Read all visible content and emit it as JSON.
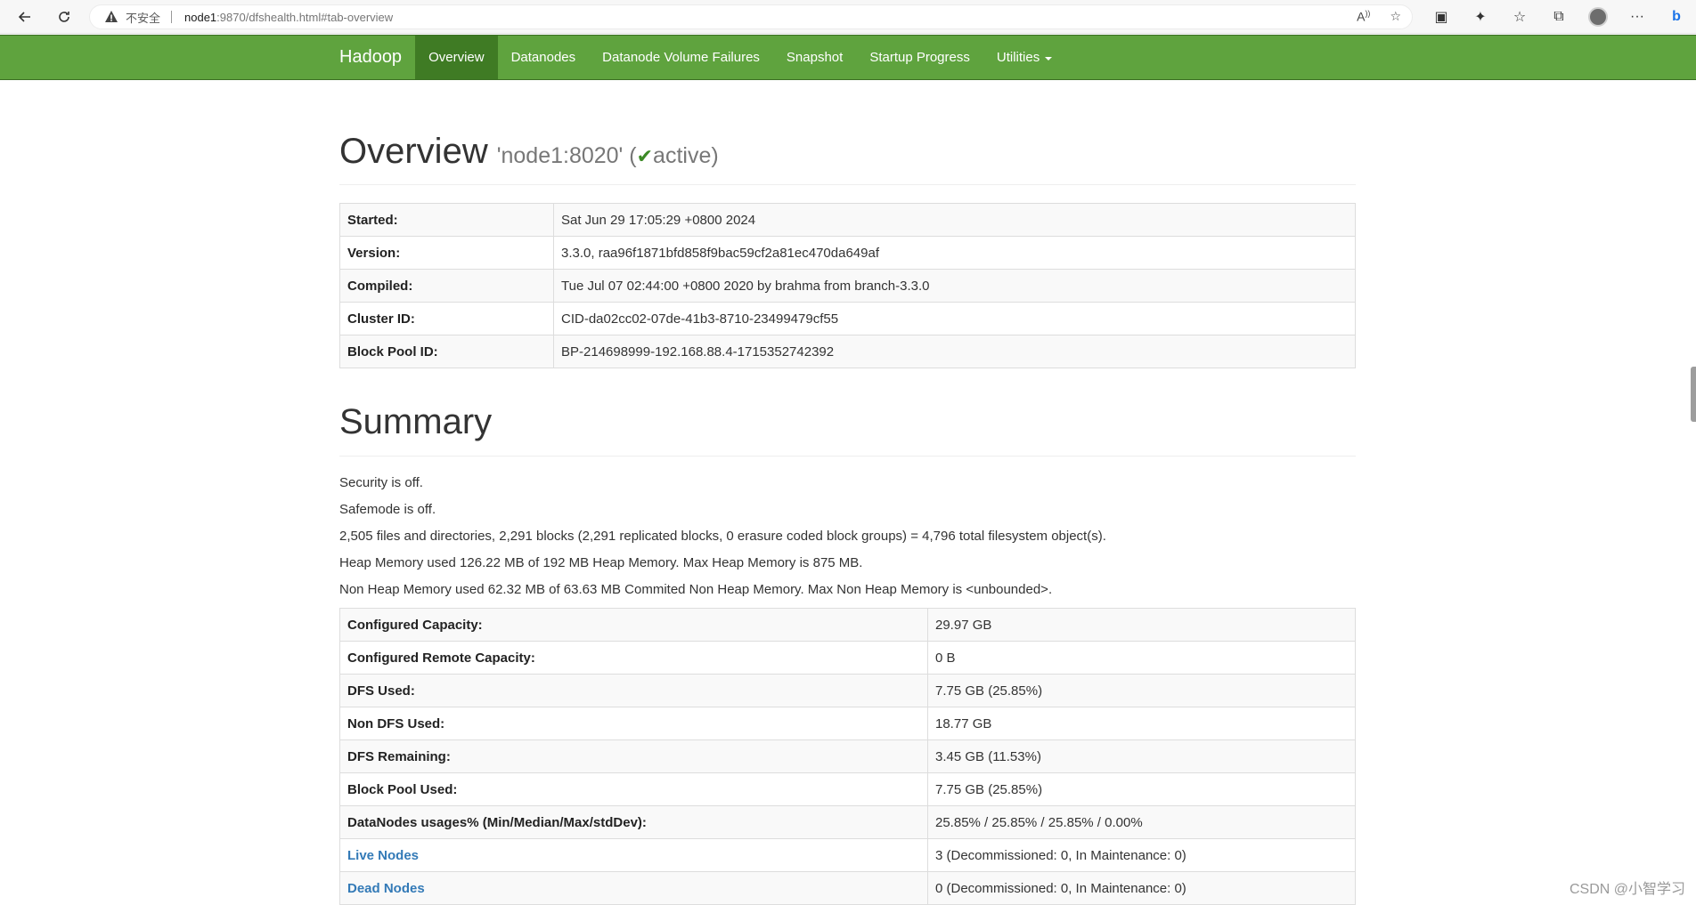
{
  "browser": {
    "insecure_label": "不安全",
    "url_host": "node1",
    "url_rest": ":9870/dfshealth.html#tab-overview"
  },
  "navbar": {
    "brand": "Hadoop",
    "items": [
      {
        "label": "Overview",
        "active": true
      },
      {
        "label": "Datanodes"
      },
      {
        "label": "Datanode Volume Failures"
      },
      {
        "label": "Snapshot"
      },
      {
        "label": "Startup Progress"
      },
      {
        "label": "Utilities"
      }
    ]
  },
  "overview": {
    "title": "Overview",
    "address": "'node1:8020' (",
    "state": "active",
    "state_close": ")",
    "rows": [
      {
        "key": "Started:",
        "value": "Sat Jun 29 17:05:29 +0800 2024"
      },
      {
        "key": "Version:",
        "value": "3.3.0, raa96f1871bfd858f9bac59cf2a81ec470da649af"
      },
      {
        "key": "Compiled:",
        "value": "Tue Jul 07 02:44:00 +0800 2020 by brahma from branch-3.3.0"
      },
      {
        "key": "Cluster ID:",
        "value": "CID-da02cc02-07de-41b3-8710-23499479cf55"
      },
      {
        "key": "Block Pool ID:",
        "value": "BP-214698999-192.168.88.4-1715352742392"
      }
    ]
  },
  "summary": {
    "title": "Summary",
    "lines": [
      "Security is off.",
      "Safemode is off.",
      "2,505 files and directories, 2,291 blocks (2,291 replicated blocks, 0 erasure coded block groups) = 4,796 total filesystem object(s).",
      "Heap Memory used 126.22 MB of 192 MB Heap Memory. Max Heap Memory is 875 MB.",
      "Non Heap Memory used 62.32 MB of 63.63 MB Commited Non Heap Memory. Max Non Heap Memory is <unbounded>."
    ],
    "rows": [
      {
        "key": "Configured Capacity:",
        "value": "29.97 GB"
      },
      {
        "key": "Configured Remote Capacity:",
        "value": "0 B"
      },
      {
        "key": "DFS Used:",
        "value": "7.75 GB (25.85%)"
      },
      {
        "key": "Non DFS Used:",
        "value": "18.77 GB"
      },
      {
        "key": "DFS Remaining:",
        "value": "3.45 GB (11.53%)"
      },
      {
        "key": "Block Pool Used:",
        "value": "7.75 GB (25.85%)"
      },
      {
        "key": "DataNodes usages% (Min/Median/Max/stdDev):",
        "value": "25.85% / 25.85% / 25.85% / 0.00%"
      },
      {
        "key": "Live Nodes",
        "value": "3 (Decommissioned: 0, In Maintenance: 0)",
        "link": true
      },
      {
        "key": "Dead Nodes",
        "value": "0 (Decommissioned: 0, In Maintenance: 0)",
        "link": true
      }
    ]
  },
  "watermark": "CSDN @小智学习"
}
